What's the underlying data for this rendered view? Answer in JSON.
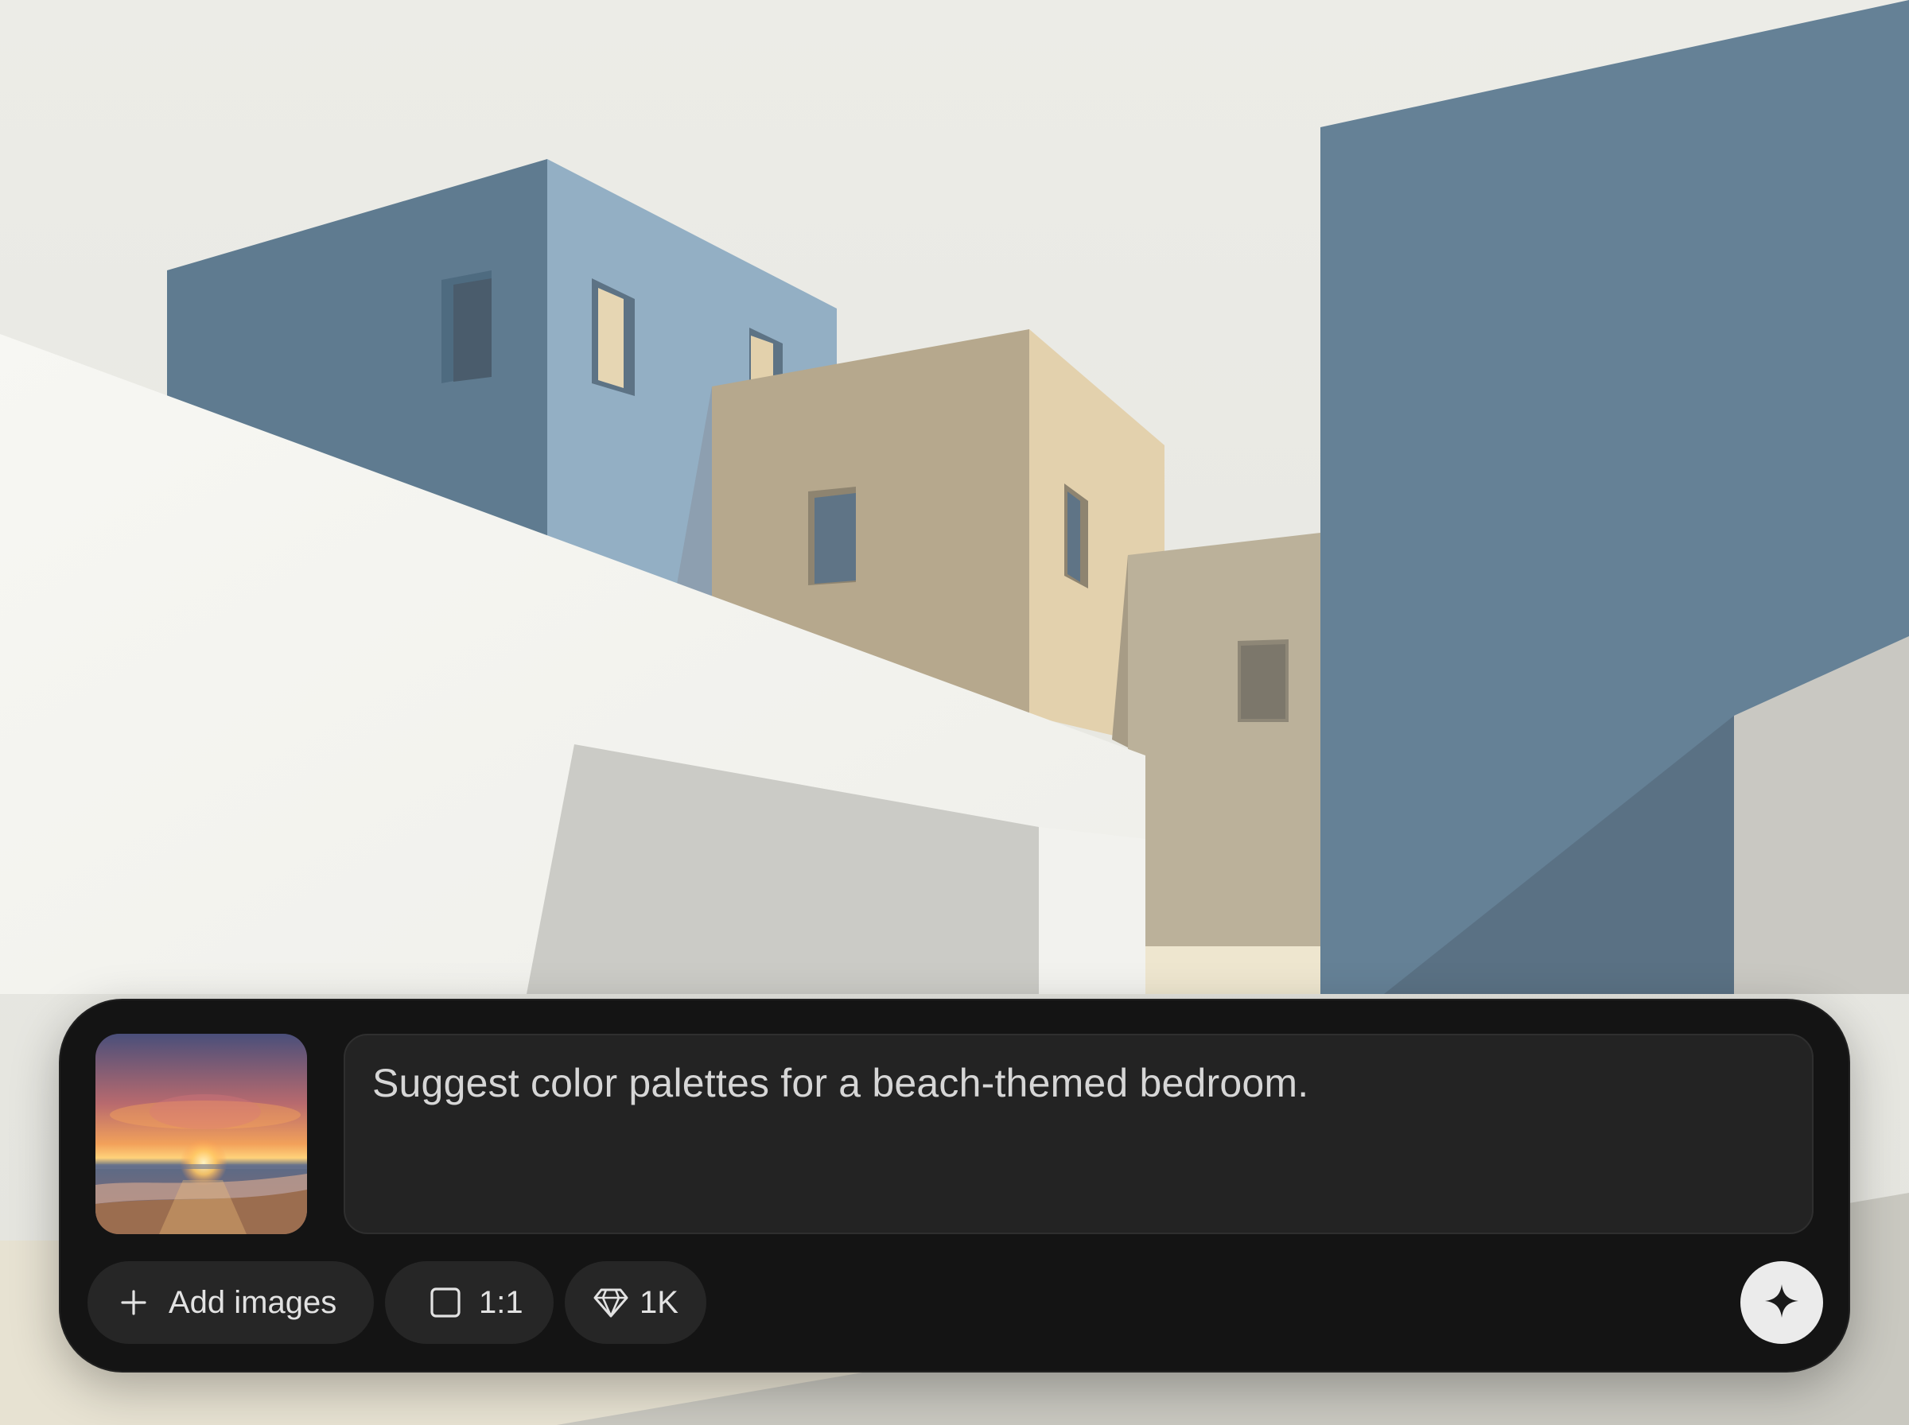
{
  "composer": {
    "reference_image": {
      "alt": "sunset beach reference image",
      "icon": "image-thumbnail"
    },
    "prompt": {
      "value": "Suggest color palettes for a beach-themed bedroom."
    },
    "toolbar": {
      "add_images": {
        "label": "Add images",
        "icon": "plus-icon"
      },
      "aspect_ratio": {
        "label": "1:1",
        "icon": "square-icon"
      },
      "quality": {
        "label": "1K",
        "icon": "diamond-icon"
      }
    },
    "submit": {
      "icon": "sparkle-icon",
      "accent": "#ebebeb"
    }
  },
  "colors": {
    "panel": "#141414",
    "input": "#232323",
    "chip": "#262626",
    "building_blue": "#65829a",
    "building_light_blue": "#93afc4",
    "building_tan": "#b6a88d",
    "building_sand": "#e2d1ad",
    "wall_white": "#f4f4f0",
    "sky": "#e9e9e4"
  }
}
